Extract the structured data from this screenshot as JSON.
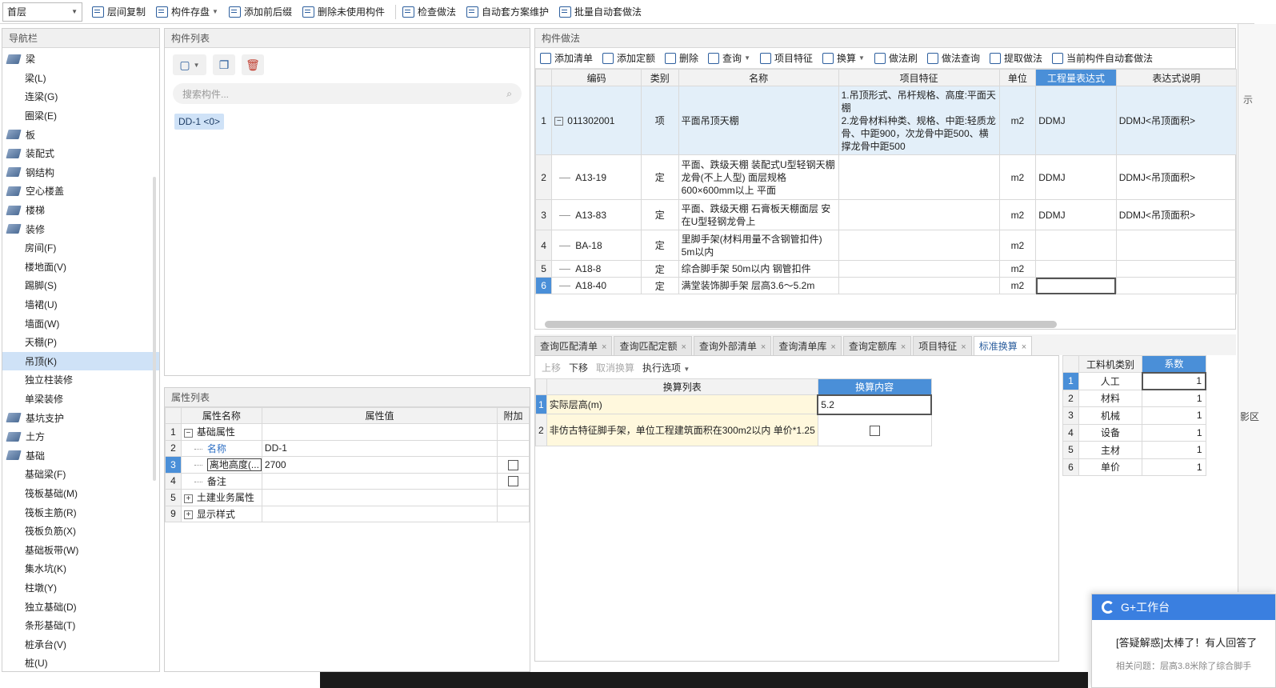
{
  "toolbar": {
    "floor": "首层",
    "items": [
      "层间复制",
      "构件存盘",
      "添加前后缀",
      "删除未使用构件",
      "检查做法",
      "自动套方案维护",
      "批量自动套做法"
    ]
  },
  "nav": {
    "title": "导航栏",
    "items": [
      {
        "label": "梁",
        "level": "cat"
      },
      {
        "label": "梁(L)",
        "level": "sub"
      },
      {
        "label": "连梁(G)",
        "level": "sub"
      },
      {
        "label": "圈梁(E)",
        "level": "sub"
      },
      {
        "label": "板",
        "level": "cat"
      },
      {
        "label": "装配式",
        "level": "cat"
      },
      {
        "label": "钢结构",
        "level": "cat"
      },
      {
        "label": "空心楼盖",
        "level": "cat"
      },
      {
        "label": "楼梯",
        "level": "cat"
      },
      {
        "label": "装修",
        "level": "cat"
      },
      {
        "label": "房间(F)",
        "level": "sub"
      },
      {
        "label": "楼地面(V)",
        "level": "sub"
      },
      {
        "label": "踢脚(S)",
        "level": "sub"
      },
      {
        "label": "墙裙(U)",
        "level": "sub"
      },
      {
        "label": "墙面(W)",
        "level": "sub"
      },
      {
        "label": "天棚(P)",
        "level": "sub"
      },
      {
        "label": "吊顶(K)",
        "level": "sub",
        "selected": true
      },
      {
        "label": "独立柱装修",
        "level": "sub"
      },
      {
        "label": "单梁装修",
        "level": "sub"
      },
      {
        "label": "基坑支护",
        "level": "cat"
      },
      {
        "label": "土方",
        "level": "cat"
      },
      {
        "label": "基础",
        "level": "cat"
      },
      {
        "label": "基础梁(F)",
        "level": "sub"
      },
      {
        "label": "筏板基础(M)",
        "level": "sub"
      },
      {
        "label": "筏板主筋(R)",
        "level": "sub"
      },
      {
        "label": "筏板负筋(X)",
        "level": "sub"
      },
      {
        "label": "基础板带(W)",
        "level": "sub"
      },
      {
        "label": "集水坑(K)",
        "level": "sub"
      },
      {
        "label": "柱墩(Y)",
        "level": "sub"
      },
      {
        "label": "独立基础(D)",
        "level": "sub"
      },
      {
        "label": "条形基础(T)",
        "level": "sub"
      },
      {
        "label": "桩承台(V)",
        "level": "sub"
      },
      {
        "label": "桩(U)",
        "level": "sub"
      }
    ]
  },
  "component_list": {
    "title": "构件列表",
    "search_placeholder": "搜索构件...",
    "item": "DD-1 <0>"
  },
  "attributes": {
    "title": "属性列表",
    "headers": [
      "属性名称",
      "属性值",
      "附加"
    ],
    "rows": [
      {
        "num": "1",
        "name": "基础属性",
        "value": "",
        "kind": "group-open"
      },
      {
        "num": "2",
        "name": "名称",
        "value": "DD-1",
        "kind": "child-link"
      },
      {
        "num": "3",
        "name": "离地高度(...",
        "value": "2700",
        "kind": "child",
        "check": true,
        "selected": true
      },
      {
        "num": "4",
        "name": "备注",
        "value": "",
        "kind": "child",
        "check": true
      },
      {
        "num": "5",
        "name": "土建业务属性",
        "value": "",
        "kind": "group-closed"
      },
      {
        "num": "9",
        "name": "显示样式",
        "value": "",
        "kind": "group-closed"
      }
    ]
  },
  "method": {
    "title": "构件做法",
    "tools": [
      "添加清单",
      "添加定额",
      "删除",
      "查询",
      "项目特征",
      "换算",
      "做法刷",
      "做法查询",
      "提取做法",
      "当前构件自动套做法"
    ],
    "headers": [
      "编码",
      "类别",
      "名称",
      "项目特征",
      "单位",
      "工程量表达式",
      "表达式说明"
    ],
    "rows": [
      {
        "num": "1",
        "code": "011302001",
        "type": "项",
        "name": "平面吊顶天棚",
        "feature": "1.吊顶形式、吊杆规格、高度:平面天棚\n2.龙骨材料种类、规格、中距:轻质龙骨、中距900，次龙骨中距500、横撑龙骨中距500",
        "unit": "m2",
        "expr": "DDMJ",
        "desc": "DDMJ<吊顶面积>"
      },
      {
        "num": "2",
        "code": "A13-19",
        "type": "定",
        "name": "平面、跌级天棚 装配式U型轻钢天棚龙骨(不上人型) 面层规格600×600mm以上 平面",
        "feature": "",
        "unit": "m2",
        "expr": "DDMJ",
        "desc": "DDMJ<吊顶面积>"
      },
      {
        "num": "3",
        "code": "A13-83",
        "type": "定",
        "name": "平面、跌级天棚 石膏板天棚面层 安在U型轻钢龙骨上",
        "feature": "",
        "unit": "m2",
        "expr": "DDMJ",
        "desc": "DDMJ<吊顶面积>"
      },
      {
        "num": "4",
        "code": "BA-18",
        "type": "定",
        "name": "里脚手架(材料用量不含钢管扣件) 5m以内",
        "feature": "",
        "unit": "m2",
        "expr": "",
        "desc": ""
      },
      {
        "num": "5",
        "code": "A18-8",
        "type": "定",
        "name": "综合脚手架 50m以内 钢管扣件",
        "feature": "",
        "unit": "m2",
        "expr": "",
        "desc": ""
      },
      {
        "num": "6",
        "code": "A18-40",
        "type": "定",
        "name": "满堂装饰脚手架 层高3.6～5.2m",
        "feature": "",
        "unit": "m2",
        "expr": "",
        "desc": ""
      }
    ]
  },
  "bottom_tabs": [
    "查询匹配清单",
    "查询匹配定额",
    "查询外部清单",
    "查询清单库",
    "查询定额库",
    "项目特征",
    "标准换算"
  ],
  "conversion": {
    "tools": [
      "上移",
      "下移",
      "取消换算",
      "执行选项"
    ],
    "headers": [
      "换算列表",
      "换算内容"
    ],
    "rows": [
      {
        "num": "1",
        "item": "实际层高(m)",
        "content": "5.2"
      },
      {
        "num": "2",
        "item": "非仿古特征脚手架，单位工程建筑面积在300m2以内 单价*1.25",
        "content": ""
      }
    ]
  },
  "coefficients": {
    "headers": [
      "工料机类别",
      "系数"
    ],
    "rows": [
      {
        "num": "1",
        "type": "人工",
        "value": "1"
      },
      {
        "num": "2",
        "type": "材料",
        "value": "1"
      },
      {
        "num": "3",
        "type": "机械",
        "value": "1"
      },
      {
        "num": "4",
        "type": "设备",
        "value": "1"
      },
      {
        "num": "5",
        "type": "主材",
        "value": "1"
      },
      {
        "num": "6",
        "type": "单价",
        "value": "1"
      }
    ]
  },
  "workbench": {
    "title": "G+工作台",
    "question": "[答疑解惑]太棒了！有人回答了",
    "related": "相关问题：层高3.8米除了综合脚手"
  },
  "edge_text": [
    "示",
    "影区"
  ]
}
